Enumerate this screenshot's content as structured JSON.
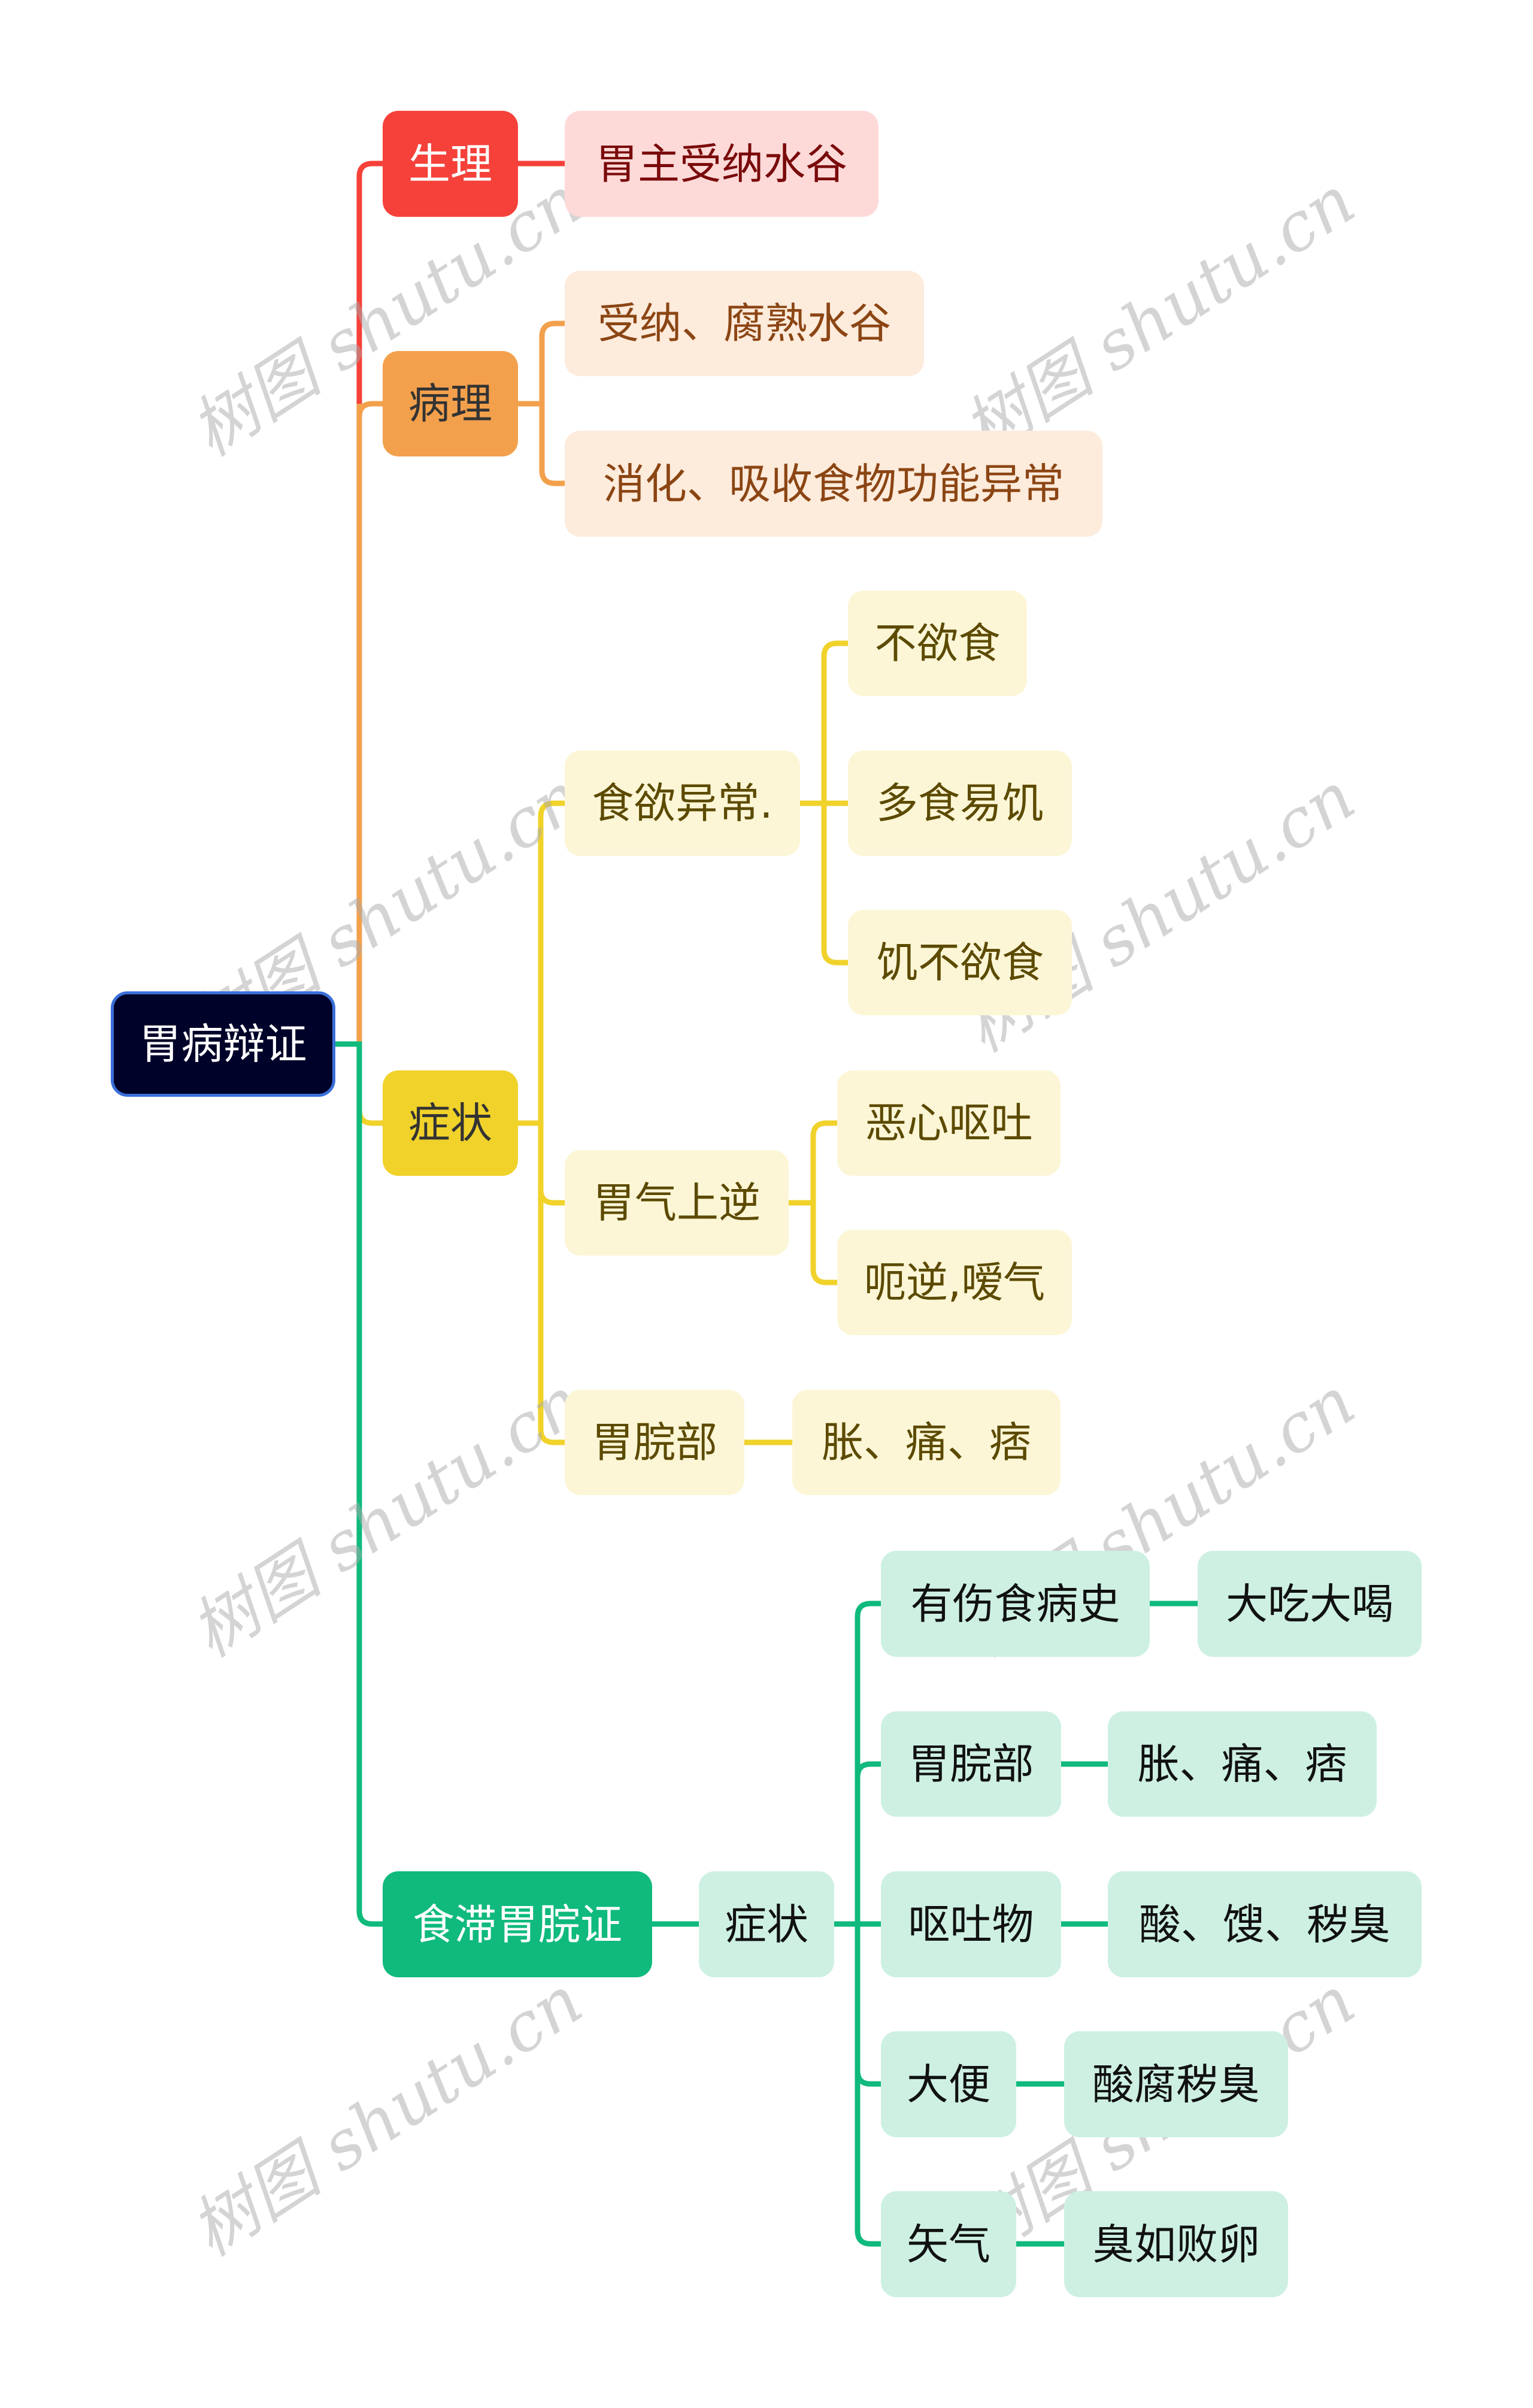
{
  "root": {
    "label": "胃病辩证"
  },
  "colors": {
    "red": "#f5413a",
    "orange": "#f3a04c",
    "yellow": "#f0d22a",
    "green": "#0fba7c",
    "root_bg": "#000229"
  },
  "branches": {
    "physiology": {
      "label": "生理",
      "children": [
        "胃主受纳水谷"
      ]
    },
    "pathology": {
      "label": "病理",
      "children": [
        "受纳、腐熟水谷",
        "消化、吸收食物功能异常"
      ]
    },
    "symptoms": {
      "label": "症状",
      "groups": [
        {
          "label": "食欲异常.",
          "children": [
            "不欲食",
            "多食易饥",
            "饥不欲食"
          ]
        },
        {
          "label": "胃气上逆",
          "children": [
            "恶心呕吐",
            "呃逆,嗳气"
          ]
        },
        {
          "label": "胃脘部",
          "children": [
            "胀、痛、痞"
          ]
        }
      ]
    },
    "food_stagnation": {
      "label": "食滞胃脘证",
      "sub": {
        "label": "症状",
        "items": [
          {
            "label": "有伤食病史",
            "detail": "大吃大喝"
          },
          {
            "label": "胃脘部",
            "detail": "胀、痛、痞"
          },
          {
            "label": "呕吐物",
            "detail": "酸、馊、秽臭"
          },
          {
            "label": "大便",
            "detail": "酸腐秽臭"
          },
          {
            "label": "矢气",
            "detail": "臭如败卵"
          }
        ]
      }
    }
  },
  "watermark": {
    "text": "树图 shutu.cn"
  }
}
